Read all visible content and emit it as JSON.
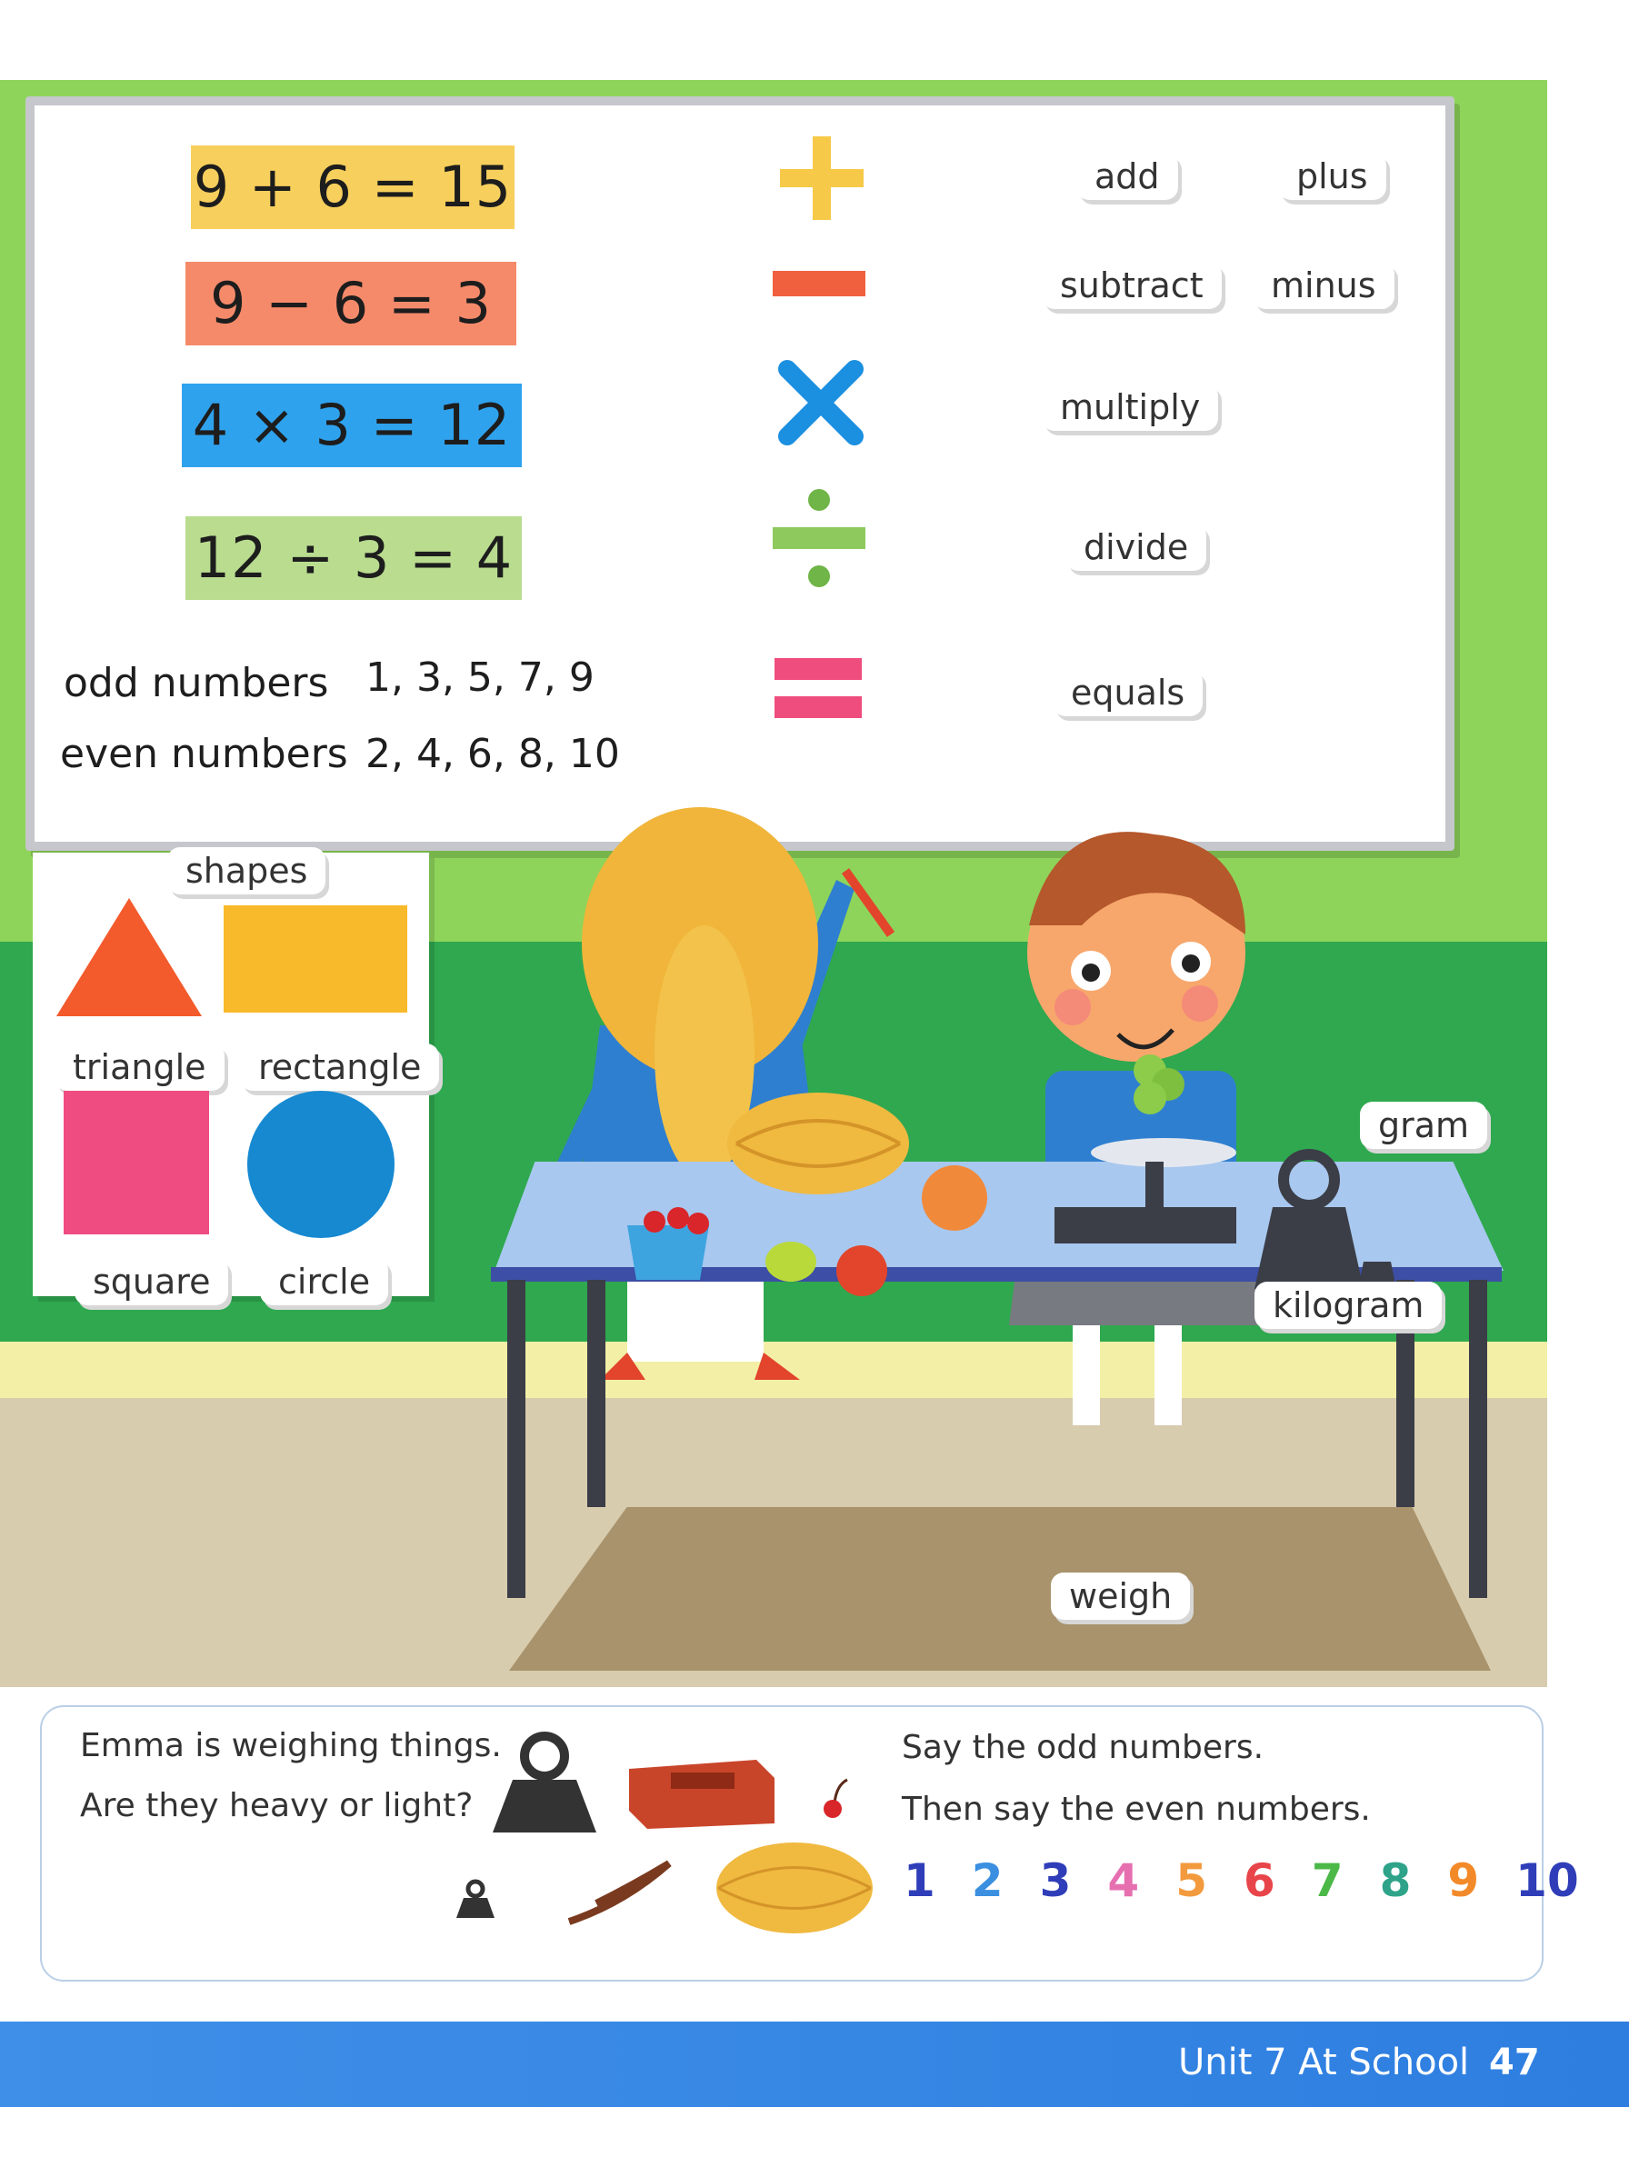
{
  "board": {
    "equations": [
      "9 + 6 = 15",
      "9 − 6 = 3",
      "4 × 3 = 12",
      "12 ÷ 3 = 4"
    ],
    "odd_label": "odd numbers",
    "odd_values": "1, 3, 5, 7, 9",
    "even_label": "even numbers",
    "even_values": "2, 4, 6, 8, 10",
    "words": {
      "add": "add",
      "plus": "plus",
      "subtract": "subtract",
      "minus": "minus",
      "multiply": "multiply",
      "divide": "divide",
      "equals": "equals"
    }
  },
  "shapes": {
    "title": "shapes",
    "items": [
      "triangle",
      "rectangle",
      "square",
      "circle"
    ]
  },
  "scene_labels": {
    "gram": "gram",
    "kilogram": "kilogram",
    "weigh": "weigh"
  },
  "activity": {
    "left_line1": "Emma is weighing things.",
    "left_line2": "Are they heavy or light?",
    "right_line1": "Say the odd numbers.",
    "right_line2": "Then say the even numbers.",
    "numbers": [
      "1",
      "2",
      "3",
      "4",
      "5",
      "6",
      "7",
      "8",
      "9",
      "10"
    ]
  },
  "footer": {
    "unit": "Unit 7  At School",
    "page": "47"
  },
  "colors": {
    "add": "#f7c948",
    "subtract": "#f0603f",
    "multiply": "#1b8fe0",
    "divide": "#8dc95d",
    "equals": "#ef4d7e",
    "triangle": "#f35a2c",
    "rectangle": "#f8b92a",
    "square": "#ef4c82",
    "circle": "#1689d1",
    "numbers": [
      "#2f3eb8",
      "#3a8fe0",
      "#2f3eb8",
      "#e66fb0",
      "#f29a3d",
      "#e8454a",
      "#4cb848",
      "#2ea38a",
      "#f38a2a",
      "#2f3eb8"
    ]
  }
}
